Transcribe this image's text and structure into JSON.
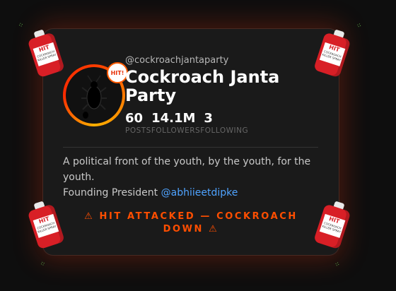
{
  "profile": {
    "handle": "@cockroachjantaparty",
    "name": "Cockroach Janta Party",
    "badge": "HIT!",
    "avatar_icon": "cockroach-icon",
    "stats": [
      {
        "value": "60",
        "label": "POSTS"
      },
      {
        "value": "14.1M",
        "label": "FOLLOWERS"
      },
      {
        "value": "3",
        "label": "FOLLOWING"
      }
    ],
    "bio": "A political front of the youth, by the youth, for the youth.",
    "founder_prefix": "Founding President",
    "founder_handle": "@abhiieetdipke",
    "alert": "⚠ HIT ATTACKED — COCKROACH DOWN ⚠"
  },
  "cans": {
    "brand": "HIT",
    "subtext": "COCKROACH KILLER SPRAY",
    "icon": "spray-can-icon"
  },
  "colors": {
    "accent": "#ff4e00",
    "link": "#4fa3ff",
    "can_red": "#d81f26"
  }
}
